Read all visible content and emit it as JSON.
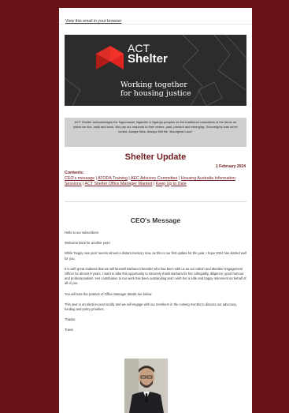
{
  "browser_link": "View this email in your browser",
  "banner": {
    "logo_line1": "ACT",
    "logo_line2": "Shelter",
    "tagline_line1": "Working together",
    "tagline_line2": "for housing justice"
  },
  "acknowledgement": "ACT Shelter acknowledges the Ngunnawal, Ngambri & Ngarigo peoples as the traditional custodians of the lands on which we live, walk and work. We pay our respects to their elders, past, present and emerging. Sovereignty was never ceded. Always Was, Always Will Be \"Aboriginal Land\"",
  "title": "Shelter Update",
  "date": "1 February 2024",
  "contents": {
    "heading": "Contents:",
    "links": [
      "CEO's message",
      "ATODA Training",
      "AEC Advisory Committee",
      "Housing Australia Information Sessions",
      "ACT Shelter Office Manager Wanted",
      "Keep Up to Date"
    ]
  },
  "ceo": {
    "heading": "CEO's Message",
    "paragraphs": [
      "Hello to our subscribers",
      "Welcome back for another year!",
      "While 'happy new year' seems almost a distant memory now, as this is our first update for the year, I hope 2024 has started well for you.",
      "It is with great sadness that we will farewell Barbara Chevalier who has been with us as our Admin and Member Engagement Officer for almost 8 years. I want to take this opportunity to sincerely thank Barbara for her collegiality, diligence, good humour and professionalism. Her contribution to our work has been outstanding and I wish her a safe and happy retirement on behalf of all of you.",
      "You will note the position of Office Manager details are below.",
      "This year is an election year locally and we will engage with our members in the coming months to discuss our advocacy, funding and policy priorities.",
      "Thanks",
      "Travis"
    ]
  },
  "colors": {
    "page_background": "#6b1418",
    "accent": "#6e1a1e",
    "logo_red": "#e0241f",
    "banner_background": "#2c2c2c"
  }
}
